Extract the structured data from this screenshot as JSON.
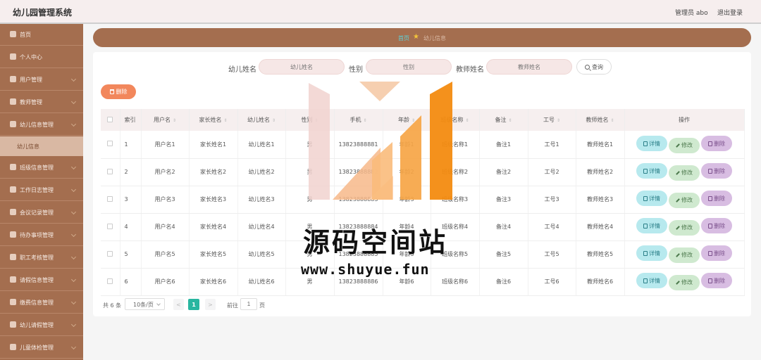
{
  "app": {
    "title": "幼儿园管理系统",
    "user": "管理员 abo",
    "logout": "退出登录"
  },
  "sidebar": {
    "items": [
      {
        "label": "首页",
        "icon": "home-icon"
      },
      {
        "label": "个人中心",
        "icon": "user-icon"
      },
      {
        "label": "用户管理",
        "icon": "users-icon"
      },
      {
        "label": "教师管理",
        "icon": "teacher-icon"
      },
      {
        "label": "幼儿信息管理",
        "icon": "child-icon"
      },
      {
        "label": "班级信息管理",
        "icon": "class-icon"
      },
      {
        "label": "工作日志管理",
        "icon": "log-icon"
      },
      {
        "label": "会议记录管理",
        "icon": "meeting-icon"
      },
      {
        "label": "待办事项管理",
        "icon": "todo-icon"
      },
      {
        "label": "职工考核管理",
        "icon": "assess-icon"
      },
      {
        "label": "请假信息管理",
        "icon": "leave-icon"
      },
      {
        "label": "缴费信息管理",
        "icon": "pay-icon"
      },
      {
        "label": "幼儿请假管理",
        "icon": "child-leave-icon"
      },
      {
        "label": "儿童体检管理",
        "icon": "health-icon"
      }
    ],
    "active_sub": "幼儿信息"
  },
  "breadcrumb": {
    "home": "首页",
    "current": "幼儿信息"
  },
  "filters": {
    "child_label": "幼儿姓名",
    "child_placeholder": "幼儿姓名",
    "gender_label": "性别",
    "gender_placeholder": "性别",
    "teacher_label": "教师姓名",
    "teacher_placeholder": "教师姓名",
    "search": "查询"
  },
  "toolbar": {
    "delete": "删除"
  },
  "table": {
    "headers": [
      "索引",
      "用户名",
      "家长姓名",
      "幼儿姓名",
      "性别",
      "手机",
      "年龄",
      "班级名称",
      "备注",
      "工号",
      "教师姓名",
      "操作"
    ],
    "rows": [
      [
        "1",
        "用户名1",
        "家长姓名1",
        "幼儿姓名1",
        "男",
        "13823888881",
        "年龄1",
        "班级名称1",
        "备注1",
        "工号1",
        "教师姓名1"
      ],
      [
        "2",
        "用户名2",
        "家长姓名2",
        "幼儿姓名2",
        "男",
        "13823888882",
        "年龄2",
        "班级名称2",
        "备注2",
        "工号2",
        "教师姓名2"
      ],
      [
        "3",
        "用户名3",
        "家长姓名3",
        "幼儿姓名3",
        "男",
        "13823888883",
        "年龄3",
        "班级名称3",
        "备注3",
        "工号3",
        "教师姓名3"
      ],
      [
        "4",
        "用户名4",
        "家长姓名4",
        "幼儿姓名4",
        "男",
        "13823888884",
        "年龄4",
        "班级名称4",
        "备注4",
        "工号4",
        "教师姓名4"
      ],
      [
        "5",
        "用户名5",
        "家长姓名5",
        "幼儿姓名5",
        "男",
        "13823888885",
        "年龄5",
        "班级名称5",
        "备注5",
        "工号5",
        "教师姓名5"
      ],
      [
        "6",
        "用户名6",
        "家长姓名6",
        "幼儿姓名6",
        "男",
        "13823888886",
        "年龄6",
        "班级名称6",
        "备注6",
        "工号6",
        "教师姓名6"
      ]
    ],
    "actions": {
      "detail": "详情",
      "edit": "修改",
      "delete": "删除"
    }
  },
  "pagination": {
    "total": "共 6 条",
    "page_size": "10条/页",
    "prev": "<",
    "current": "1",
    "next": ">",
    "goto": "前往",
    "goto_value": "1",
    "unit": "页"
  },
  "watermark": {
    "title": "源码空间站",
    "url": "www.shuyue.fun"
  },
  "colors": {
    "sidebar": "#a46e4f",
    "accent_orange": "#f2875c",
    "active_page": "#29b6a0"
  }
}
